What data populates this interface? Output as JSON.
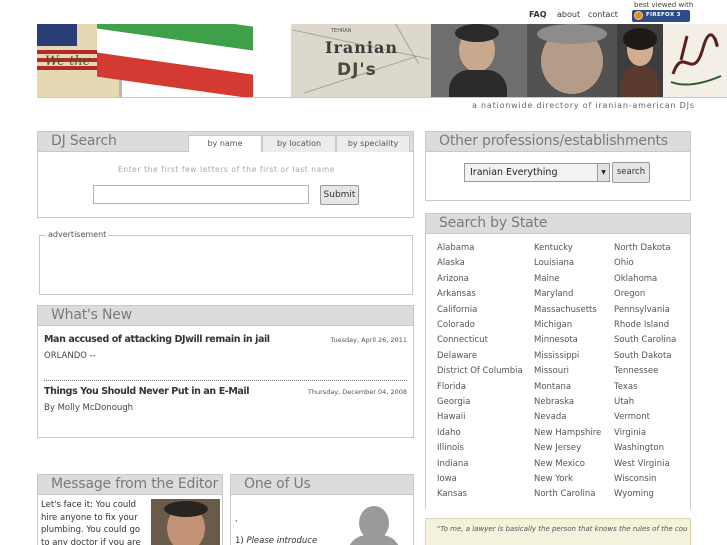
{
  "topnav": {
    "faq": "FAQ",
    "about": "about",
    "contact": "contact",
    "best_viewed": "best viewed with",
    "firefox_badge": "FIREFOX 3"
  },
  "banner": {
    "constitution_text": "We the",
    "map_label": "TEHRAN",
    "logo_line1": "Iranian",
    "logo_line2": "DJ's",
    "tagline": "a nationwide directory of iranian-american DJs"
  },
  "dj_search": {
    "title": "DJ Search",
    "tabs": [
      "by name",
      "by location",
      "by speciality"
    ],
    "hint": "Enter the first few letters of the first or last name",
    "input_value": "",
    "submit_label": "Submit"
  },
  "advertisement": {
    "label": "advertisement"
  },
  "whats_new": {
    "title": "What's New",
    "items": [
      {
        "title": "Man accused of attacking DJwill remain in jail",
        "date": "Tuesday, April 26, 2011",
        "excerpt": "ORLANDO --"
      },
      {
        "title": "Things You Should Never Put in an E-Mail",
        "date": "Thursday, December 04, 2008",
        "excerpt": "By Molly McDonough"
      }
    ]
  },
  "editor": {
    "title": "Message from the Editor",
    "text": "Let's face it: You could hire anyone to fix your plumbing. You could go to any doctor if you are sick."
  },
  "one_of_us": {
    "title": "One of Us",
    "dot": ",",
    "intro_prefix": "1) ",
    "intro_text": "Please introduce"
  },
  "other_professions": {
    "title": "Other professions/establishments",
    "selected": "Iranian Everything",
    "search_label": "search"
  },
  "by_state": {
    "title": "Search by State",
    "columns": [
      [
        "Alabama",
        "Alaska",
        "Arizona",
        "Arkansas",
        "California",
        "Colorado",
        "Connecticut",
        "Delaware",
        "District Of Columbia",
        "Florida",
        "Georgia",
        "Hawaii",
        "Idaho",
        "Illinois",
        "Indiana",
        "Iowa",
        "Kansas"
      ],
      [
        "Kentucky",
        "Louisiana",
        "Maine",
        "Maryland",
        "Massachusetts",
        "Michigan",
        "Minnesota",
        "Mississippi",
        "Missouri",
        "Montana",
        "Nebraska",
        "Nevada",
        "New Hampshire",
        "New Jersey",
        "New Mexico",
        "New York",
        "North Carolina"
      ],
      [
        "North Dakota",
        "Ohio",
        "Oklahoma",
        "Oregon",
        "Pennsylvania",
        "Rhode Island",
        "South Carolina",
        "South Dakota",
        "Tennessee",
        "Texas",
        "Utah",
        "Vermont",
        "Virginia",
        "Washington",
        "West Virginia",
        "Wisconsin",
        "Wyoming"
      ]
    ]
  },
  "quote": {
    "text": "\"To me, a lawyer is basically the person that knows the rules of the country. We're all throwing the dice, playing the game, moving our"
  },
  "colors": {
    "panel_header_bg": "#dcdcdc",
    "panel_title": "#7a7a7a",
    "quote_bg": "#f4f1dc"
  }
}
